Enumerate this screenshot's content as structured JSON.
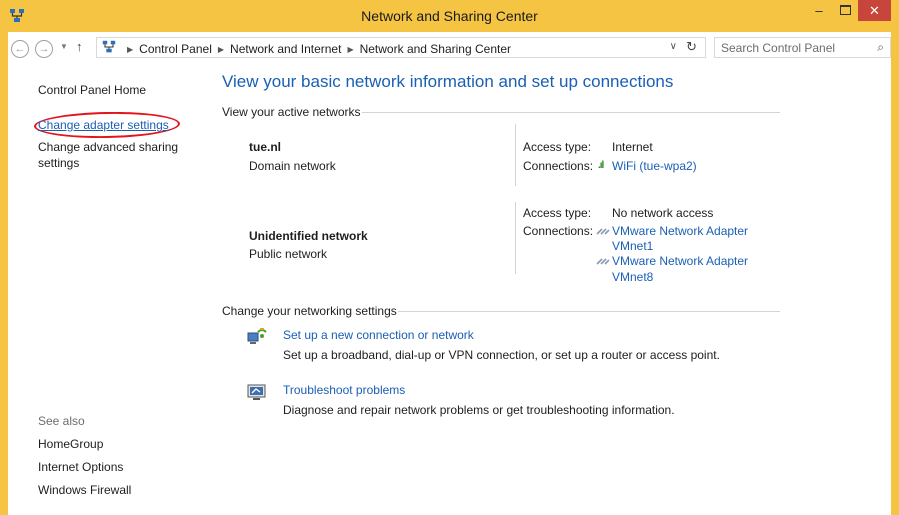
{
  "window": {
    "title": "Network and Sharing Center",
    "minimize_label": "–",
    "close_label": "✕",
    "icon": "network-sharing-icon"
  },
  "address_bar": {
    "back_icon": "back-arrow-icon",
    "forward_icon": "forward-arrow-icon",
    "up_icon": "up-arrow-icon",
    "breadcrumbs": [
      "Control Panel",
      "Network and Internet",
      "Network and Sharing Center"
    ],
    "search_placeholder": "Search Control Panel"
  },
  "sidebar": {
    "home": "Control Panel Home",
    "links": [
      "Change adapter settings",
      "Change advanced sharing settings"
    ],
    "see_also_label": "See also",
    "see_also": [
      "HomeGroup",
      "Internet Options",
      "Windows Firewall"
    ]
  },
  "main": {
    "heading": "View your basic network information and set up connections",
    "active_networks_label": "View your active networks",
    "networks": [
      {
        "name": "tue.nl",
        "type": "Domain network",
        "access_type_label": "Access type:",
        "access_type": "Internet",
        "connections_label": "Connections:",
        "connections": [
          "WiFi (tue-wpa2)"
        ]
      },
      {
        "name": "Unidentified network",
        "type": "Public network",
        "access_type_label": "Access type:",
        "access_type": "No network access",
        "connections_label": "Connections:",
        "connections": [
          "VMware Network Adapter",
          "VMnet1",
          "VMware Network Adapter",
          "VMnet8"
        ]
      }
    ],
    "change_settings_label": "Change your networking settings",
    "tasks": [
      {
        "link": "Set up a new connection or network",
        "desc": "Set up a broadband, dial-up or VPN connection, or set up a router or access point."
      },
      {
        "link": "Troubleshoot problems",
        "desc": "Diagnose and repair network problems or get troubleshooting information."
      }
    ]
  },
  "colors": {
    "frame": "#f5c443",
    "link": "#1a5fb4",
    "close": "#c7453a",
    "highlight_oval": "#e3141b"
  }
}
